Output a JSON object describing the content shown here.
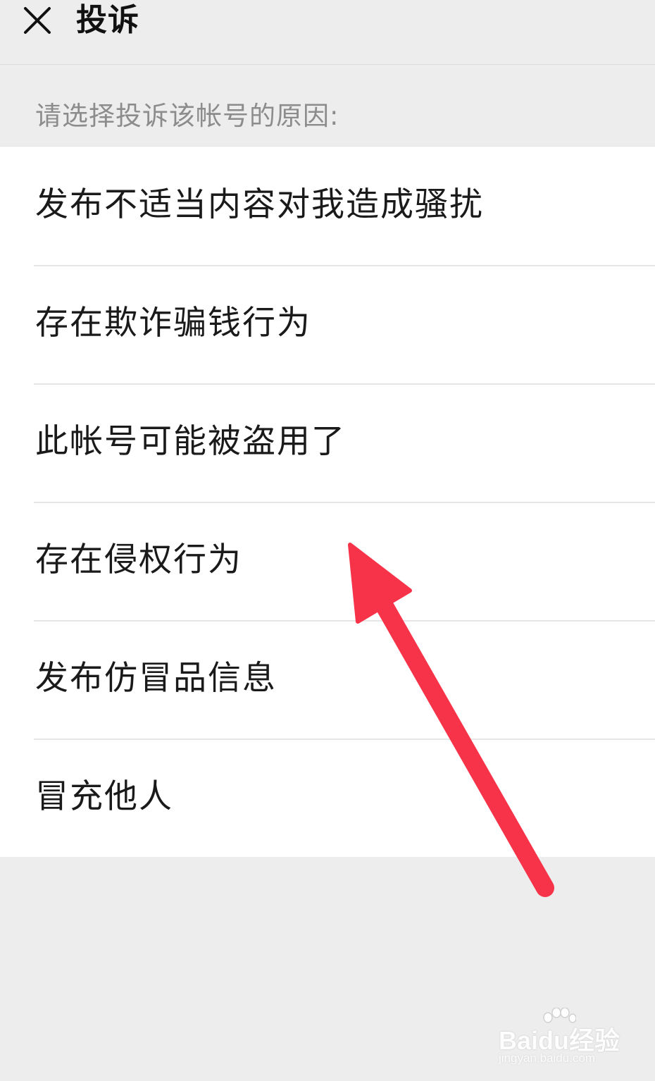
{
  "header": {
    "title": "投诉"
  },
  "prompt": "请选择投诉该帐号的原因:",
  "reasons": [
    {
      "label": "发布不适当内容对我造成骚扰"
    },
    {
      "label": "存在欺诈骗钱行为"
    },
    {
      "label": "此帐号可能被盗用了"
    },
    {
      "label": "存在侵权行为"
    },
    {
      "label": "发布仿冒品信息"
    },
    {
      "label": "冒充他人"
    }
  ],
  "watermark": {
    "brand_a": "Bai",
    "brand_b": "du",
    "brand_c": "经验",
    "url": "jingyan.baidu.com"
  },
  "colors": {
    "background": "#ededed",
    "list_background": "#ffffff",
    "arrow": "#f7334a"
  },
  "icons": {
    "close": "close-icon"
  }
}
